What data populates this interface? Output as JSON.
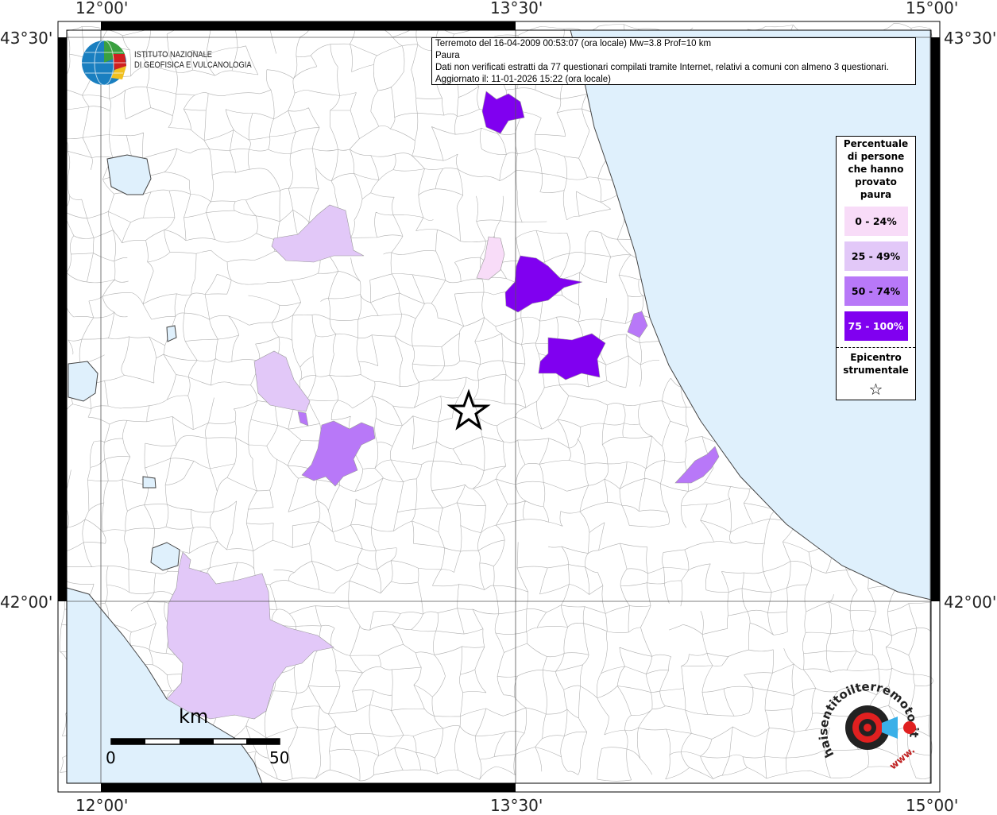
{
  "info": {
    "line1": "Terremoto del 16-04-2009 00:53:07 (ora locale) Mw=3.8 Prof=10 km",
    "line2": "Paura",
    "line3": "Dati non verificati estratti da 77 questionari compilati tramite Internet, relativi a comuni con almeno 3 questionari.",
    "line4": "Aggiornato il: 11-01-2026 15:22 (ora locale)"
  },
  "axes": {
    "top": [
      "12°00'",
      "13°30'",
      "15°00'"
    ],
    "bottom": [
      "12°00'",
      "13°30'",
      "15°00'"
    ],
    "left": [
      "43°30'",
      "42°00'"
    ],
    "right": [
      "43°30'",
      "42°00'"
    ]
  },
  "legend": {
    "title_lines": [
      "Percentuale",
      "di persone",
      "che hanno",
      "provato",
      "paura"
    ],
    "classes": [
      {
        "label": "0 - 24%",
        "color": "#f8dcf8",
        "text_color": "#000000"
      },
      {
        "label": "25 - 49%",
        "color": "#e2c8f8",
        "text_color": "#000000"
      },
      {
        "label": "50 - 74%",
        "color": "#b878f8",
        "text_color": "#000000"
      },
      {
        "label": "75 - 100%",
        "color": "#8000f0",
        "text_color": "#ffffff"
      }
    ],
    "epicenter_lines": [
      "Epicentro",
      "strumentale"
    ],
    "epicenter_symbol": "☆"
  },
  "logo_ingv": {
    "line1": "ISTITUTO NAZIONALE",
    "line2": "DI GEOFISICA E VULCANOLOGIA"
  },
  "logo_hsit": {
    "text": "haisentitoilterremoto.it",
    "url_text": "www."
  },
  "scale": {
    "unit": "km",
    "min": "0",
    "max": "50"
  },
  "colors": {
    "sea": "#dff0fc",
    "boundary": "#b0b0b0"
  }
}
